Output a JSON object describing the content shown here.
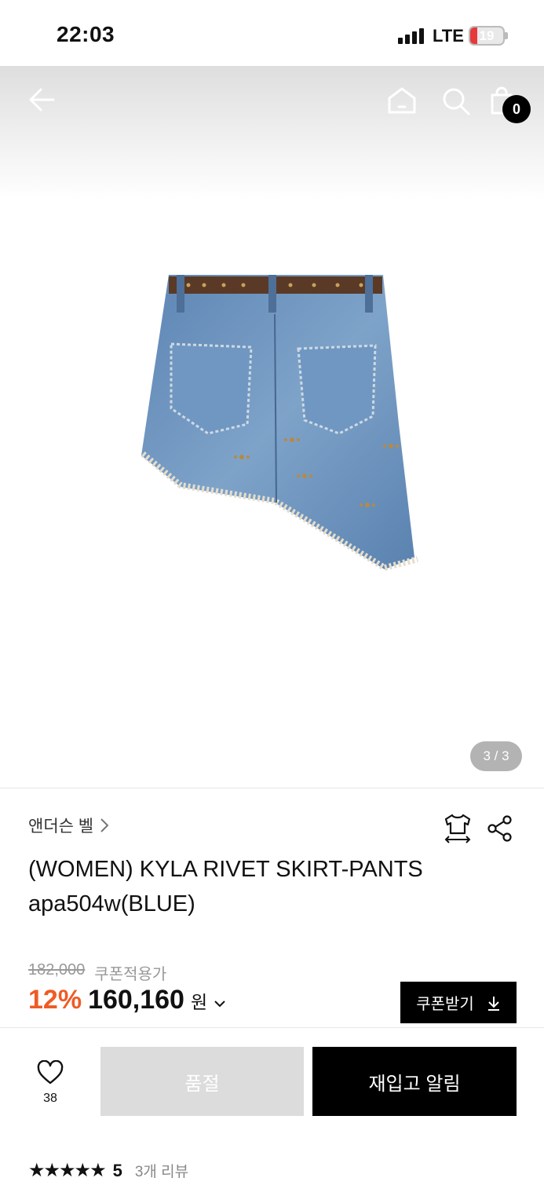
{
  "status_bar": {
    "time": "22:03",
    "network": "LTE",
    "battery": "19"
  },
  "header": {
    "cart_count": "0"
  },
  "gallery": {
    "page_indicator": "3 / 3"
  },
  "product": {
    "brand": "앤더슨 벨",
    "title": "(WOMEN) KYLA RIVET SKIRT-PANTS apa504w(BLUE)",
    "original_price": "182,000",
    "coupon_note": "쿠폰적용가",
    "discount": "12%",
    "price": "160,160",
    "currency": "원",
    "coupon_button": "쿠폰받기"
  },
  "bottom_bar": {
    "like_count": "38",
    "soldout_label": "품절",
    "restock_label": "재입고 알림"
  },
  "reviews": {
    "rating": "5",
    "count_label": "3개 리뷰"
  },
  "colors": {
    "discount": "#ef5b25",
    "black": "#000000",
    "soldout_bg": "#dcdcdc"
  }
}
